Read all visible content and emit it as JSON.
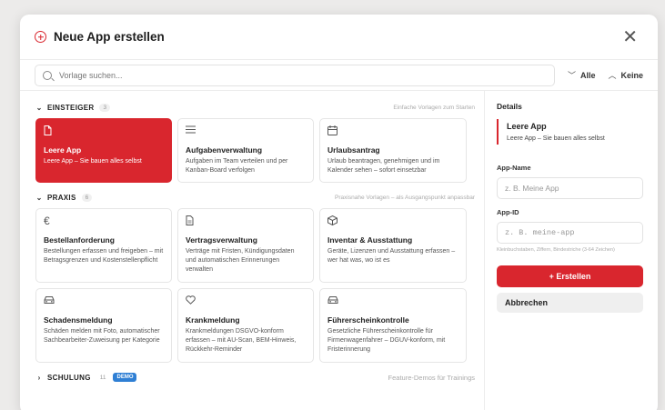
{
  "dialog": {
    "title": "Neue App erstellen",
    "close_icon": "close-icon"
  },
  "search": {
    "placeholder": "Vorlage suchen...",
    "expand_all": "Alle",
    "collapse_all": "Keine"
  },
  "sections": {
    "einsteiger": {
      "name": "EINSTEIGER",
      "count": "3",
      "desc": "Einfache Vorlagen zum Starten",
      "cards": [
        {
          "icon": "document-icon",
          "title": "Leere App",
          "desc": "Leere App – Sie bauen alles selbst"
        },
        {
          "icon": "list-icon",
          "title": "Aufgabenverwaltung",
          "desc": "Aufgaben im Team verteilen und per Kanban-Board verfolgen"
        },
        {
          "icon": "calendar-icon",
          "title": "Urlaubsantrag",
          "desc": "Urlaub beantragen, genehmigen und im Kalender sehen – sofort einsetzbar"
        }
      ]
    },
    "praxis": {
      "name": "PRAXIS",
      "count": "6",
      "desc": "Praxisnahe Vorlagen – als Ausgangspunkt anpassbar",
      "cards": [
        {
          "icon": "euro-icon",
          "title": "Bestellanforderung",
          "desc": "Bestellungen erfassen und freigeben – mit Betragsgrenzen und Kostenstellenpflicht"
        },
        {
          "icon": "contract-icon",
          "title": "Vertragsverwaltung",
          "desc": "Verträge mit Fristen, Kündigungsdaten und automatischen Erinnerungen verwalten"
        },
        {
          "icon": "box-icon",
          "title": "Inventar & Ausstattung",
          "desc": "Geräte, Lizenzen und Ausstattung erfassen – wer hat was, wo ist es"
        },
        {
          "icon": "car-icon",
          "title": "Schadensmeldung",
          "desc": "Schäden melden mit Foto, automatischer Sachbearbeiter-Zuweisung per Kategorie"
        },
        {
          "icon": "heart-icon",
          "title": "Krankmeldung",
          "desc": "Krankmeldungen DSGVO-konform erfassen – mit AU-Scan, BEM-Hinweis, Rückkehr-Reminder"
        },
        {
          "icon": "car-icon",
          "title": "Führerscheinkontrolle",
          "desc": "Gesetzliche Führerscheinkontrolle für Firmenwagenfahrer – DGUV-konform, mit Fristerinnerung"
        }
      ]
    },
    "schulung": {
      "name": "SCHULUNG",
      "count": "11",
      "badge": "DEMO",
      "desc": "Feature-Demos für Trainings"
    }
  },
  "details": {
    "heading": "Details",
    "preview_title": "Leere App",
    "preview_desc": "Leere App – Sie bauen alles selbst",
    "app_name_label": "App-Name",
    "app_name_placeholder": "z. B. Meine App",
    "app_id_label": "App-ID",
    "app_id_placeholder": "z. B. meine-app",
    "app_id_hint": "Kleinbuchstaben, Ziffern, Bindestriche (3-64 Zeichen)",
    "create_label": "+ Erstellen",
    "cancel_label": "Abbrechen"
  },
  "colors": {
    "accent": "#d9262e",
    "badge_blue": "#2f7fd4"
  }
}
